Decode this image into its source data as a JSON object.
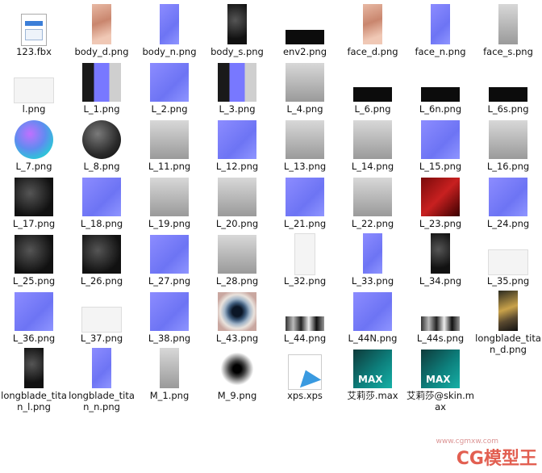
{
  "files": [
    {
      "name": "123.fbx",
      "kind": "fbx-file-icon"
    },
    {
      "name": "body_d.png",
      "kind": "skin-thumbnail"
    },
    {
      "name": "body_n.png",
      "kind": "normal-map-thumbnail"
    },
    {
      "name": "body_s.png",
      "kind": "dark-thumbnail"
    },
    {
      "name": "env2.png",
      "kind": "black-thumbnail"
    },
    {
      "name": "face_d.png",
      "kind": "skin-thumbnail"
    },
    {
      "name": "face_n.png",
      "kind": "normal-map-thumbnail"
    },
    {
      "name": "face_s.png",
      "kind": "gray-thumbnail"
    },
    {
      "name": "l.png",
      "kind": "white-thumbnail"
    },
    {
      "name": "L_1.png",
      "kind": "mixed-thumbnail"
    },
    {
      "name": "L_2.png",
      "kind": "normal-map-thumbnail"
    },
    {
      "name": "L_3.png",
      "kind": "mixed-thumbnail"
    },
    {
      "name": "L_4.png",
      "kind": "gray-thumbnail"
    },
    {
      "name": "L_6.png",
      "kind": "black-thumbnail"
    },
    {
      "name": "L_6n.png",
      "kind": "black-thumbnail"
    },
    {
      "name": "L_6s.png",
      "kind": "black-thumbnail"
    },
    {
      "name": "L_7.png",
      "kind": "sphere-thumbnail"
    },
    {
      "name": "L_8.png",
      "kind": "dark-sphere-thumbnail"
    },
    {
      "name": "L_11.png",
      "kind": "gray-thumbnail"
    },
    {
      "name": "L_12.png",
      "kind": "normal-map-thumbnail"
    },
    {
      "name": "L_13.png",
      "kind": "gray-thumbnail"
    },
    {
      "name": "L_14.png",
      "kind": "gray-thumbnail"
    },
    {
      "name": "L_15.png",
      "kind": "normal-map-thumbnail"
    },
    {
      "name": "L_16.png",
      "kind": "gray-thumbnail"
    },
    {
      "name": "L_17.png",
      "kind": "dark-thumbnail"
    },
    {
      "name": "L_18.png",
      "kind": "normal-map-thumbnail"
    },
    {
      "name": "L_19.png",
      "kind": "gray-thumbnail"
    },
    {
      "name": "L_20.png",
      "kind": "gray-thumbnail"
    },
    {
      "name": "L_21.png",
      "kind": "normal-map-thumbnail"
    },
    {
      "name": "L_22.png",
      "kind": "gray-thumbnail"
    },
    {
      "name": "L_23.png",
      "kind": "red-thumbnail"
    },
    {
      "name": "L_24.png",
      "kind": "normal-map-thumbnail"
    },
    {
      "name": "L_25.png",
      "kind": "dark-thumbnail"
    },
    {
      "name": "L_26.png",
      "kind": "dark-thumbnail"
    },
    {
      "name": "L_27.png",
      "kind": "normal-map-thumbnail"
    },
    {
      "name": "L_28.png",
      "kind": "gray-thumbnail"
    },
    {
      "name": "L_32.png",
      "kind": "white-thumbnail"
    },
    {
      "name": "L_33.png",
      "kind": "normal-map-thumbnail"
    },
    {
      "name": "L_34.png",
      "kind": "dark-thumbnail"
    },
    {
      "name": "L_35.png",
      "kind": "white-thumbnail"
    },
    {
      "name": "L_36.png",
      "kind": "normal-map-thumbnail"
    },
    {
      "name": "L_37.png",
      "kind": "white-thumbnail"
    },
    {
      "name": "L_38.png",
      "kind": "normal-map-thumbnail"
    },
    {
      "name": "L_43.png",
      "kind": "eye-thumbnail"
    },
    {
      "name": "L_44.png",
      "kind": "strip-thumbnail"
    },
    {
      "name": "L_44N.png",
      "kind": "normal-map-thumbnail"
    },
    {
      "name": "L_44s.png",
      "kind": "strip-thumbnail"
    },
    {
      "name": "longblade_titan_d.png",
      "kind": "gold-thumbnail"
    },
    {
      "name": "longblade_titan_l.png",
      "kind": "dark-thumbnail"
    },
    {
      "name": "longblade_titan_n.png",
      "kind": "normal-map-thumbnail"
    },
    {
      "name": "M_1.png",
      "kind": "gray-thumbnail"
    },
    {
      "name": "M_9.png",
      "kind": "feather-thumbnail"
    },
    {
      "name": "xps.xps",
      "kind": "xps-file-icon"
    },
    {
      "name": "艾莉莎.max",
      "kind": "max-file-icon"
    },
    {
      "name": "艾莉莎@skin.max",
      "kind": "max-file-icon"
    }
  ],
  "max_badge": "MAX",
  "watermark": {
    "text": "CG模型王",
    "sub": "www.cgmxw.com"
  }
}
